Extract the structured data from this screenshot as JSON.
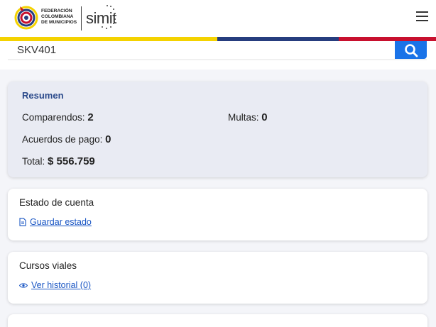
{
  "header": {
    "org_line1": "FEDERACIÓN",
    "org_line2": "COLOMBIANA",
    "org_line3": "DE MUNICIPIOS",
    "brand": "simit"
  },
  "flag_colors": {
    "yellow": "#f4d200",
    "blue": "#263d7e",
    "red": "#c8102e"
  },
  "search": {
    "value": "SKV401",
    "button_icon": "search-icon"
  },
  "summary": {
    "title": "Resumen",
    "comparendos_label": "Comparendos:",
    "comparendos_value": "2",
    "multas_label": "Multas:",
    "multas_value": "0",
    "acuerdos_label": "Acuerdos de pago:",
    "acuerdos_value": "0",
    "total_label": "Total:",
    "total_value": "$ 556.759"
  },
  "account": {
    "title": "Estado de cuenta",
    "link": "Guardar estado",
    "link_icon": "document-icon"
  },
  "courses": {
    "title": "Cursos viales",
    "link": "Ver historial (0)",
    "link_icon": "eye-icon"
  },
  "colors": {
    "accent": "#1a73e8",
    "link": "#1a56c4",
    "summary_title": "#2b4a8b"
  }
}
